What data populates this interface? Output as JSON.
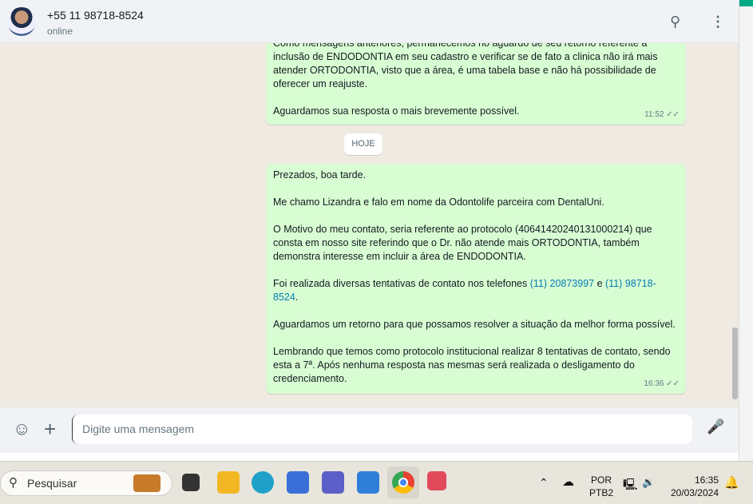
{
  "header": {
    "contact": "+55 11 98718-8524",
    "status": "online",
    "search_icon": "search-icon",
    "menu_icon": "kebab-menu-icon"
  },
  "messages": [
    {
      "paragraphs": [
        "Como mensagens anteriores, permanecemos no aguardo de seu retorno referente a inclusão de ENDODONTIA em seu cadastro e verificar se de fato a clinica não irá mais atender ORTODONTIA, visto que a área, é uma tabela base e não há possibilidade de oferecer um reajuste.",
        "Aguardamos sua resposta o mais brevemente possível."
      ],
      "time": "11:52"
    },
    {
      "paragraphs": [
        "Prezados, boa tarde.",
        "Me chamo Lizandra e falo em nome da Odontolife parceira com DentalUni.",
        "O Motivo do meu contato, seria referente ao protocolo (40641420240131000214) que consta em nosso site referindo que o Dr. não atende mais ORTODONTIA, também demonstra interesse em incluir a área de ENDODONTIA."
      ],
      "p4_prefix": "Foi realizada diversas tentativas de contato nos telefones ",
      "phone1": "(11) 20873997",
      "p4_mid": " e ",
      "phone2": "(11) 98718-8524",
      "p4_suffix": ".",
      "p5": "Aguardamos um retorno para que possamos resolver a situação da melhor forma possível.",
      "p6": "Lembrando que temos como protocolo institucional realizar 8 tentativas de contato, sendo esta a 7ª. Após nenhuma resposta nas mesmas será realizada o desligamento do credenciamento.",
      "time": "16:36"
    }
  ],
  "day_label": "HOJE",
  "composer": {
    "placeholder": "Digite uma mensagem"
  },
  "taskbar": {
    "search_label": "Pesquisar",
    "lang1": "POR",
    "lang2": "PTB2",
    "time": "16:35",
    "date": "20/03/2024"
  }
}
